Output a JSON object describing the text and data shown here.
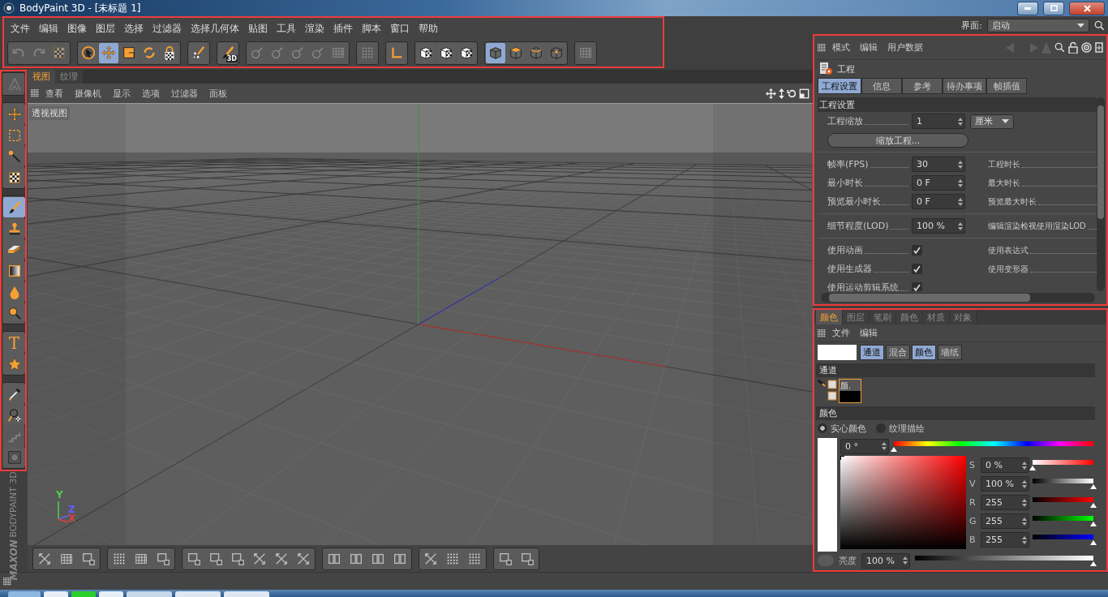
{
  "window": {
    "title": "BodyPaint 3D - [未标题 1]"
  },
  "menu": [
    "文件",
    "编辑",
    "图像",
    "图层",
    "选择",
    "过滤器",
    "选择几何体",
    "贴图",
    "工具",
    "渲染",
    "插件",
    "脚本",
    "窗口",
    "帮助"
  ],
  "toolbar": [
    [
      {
        "kind": "undo",
        "selected": false,
        "disabled": true
      },
      {
        "kind": "redo",
        "selected": false,
        "disabled": true
      },
      {
        "kind": "checker",
        "selected": false,
        "disabled": true
      }
    ],
    [
      {
        "kind": "cursor",
        "selected": false,
        "disabled": false
      },
      {
        "kind": "move",
        "selected": true,
        "disabled": false
      },
      {
        "kind": "scale",
        "selected": false,
        "disabled": false
      },
      {
        "kind": "rotate",
        "selected": false,
        "disabled": false
      },
      {
        "kind": "lock",
        "selected": false,
        "disabled": false
      }
    ],
    [
      {
        "kind": "sparkle",
        "selected": false,
        "disabled": false
      }
    ],
    [
      {
        "kind": "brush",
        "label": "3D",
        "selected": false,
        "disabled": false
      }
    ],
    [
      {
        "kind": "pin",
        "selected": false,
        "disabled": true
      },
      {
        "kind": "pin",
        "selected": false,
        "disabled": true
      },
      {
        "kind": "pin",
        "selected": false,
        "disabled": true
      },
      {
        "kind": "pin",
        "selected": false,
        "disabled": true
      },
      {
        "kind": "grid",
        "selected": false,
        "disabled": true
      }
    ],
    [
      {
        "kind": "dots",
        "selected": false,
        "disabled": true
      }
    ],
    [
      {
        "kind": "axis",
        "selected": false,
        "disabled": false
      }
    ],
    [
      {
        "kind": "checker-cube",
        "selected": false,
        "disabled": false
      },
      {
        "kind": "checker-cube",
        "selected": false,
        "disabled": false
      },
      {
        "kind": "checker-cube",
        "selected": false,
        "disabled": false
      }
    ],
    [
      {
        "kind": "cube",
        "selected": true,
        "disabled": false
      },
      {
        "kind": "cube-face",
        "selected": false,
        "disabled": false
      },
      {
        "kind": "cube-edge",
        "selected": false,
        "disabled": false
      },
      {
        "kind": "cube-point",
        "selected": false,
        "disabled": false
      }
    ],
    [
      {
        "kind": "grid",
        "selected": false,
        "disabled": true
      }
    ]
  ],
  "layout": {
    "label": "界面:",
    "value": "启动"
  },
  "tools": [
    [
      {
        "kind": "logo",
        "selected": false,
        "disabled": true
      }
    ],
    [
      {
        "kind": "move",
        "selected": false,
        "disabled": false
      },
      {
        "kind": "rect-select",
        "selected": false,
        "disabled": false
      },
      {
        "kind": "wand",
        "selected": false,
        "disabled": false
      },
      {
        "kind": "checker",
        "selected": false,
        "disabled": false
      }
    ],
    [
      {
        "kind": "brush",
        "selected": true,
        "disabled": false
      },
      {
        "kind": "stamp",
        "selected": false,
        "disabled": false
      },
      {
        "kind": "eraser",
        "selected": false,
        "disabled": false
      },
      {
        "kind": "gradient",
        "selected": false,
        "disabled": false
      },
      {
        "kind": "drop",
        "selected": false,
        "disabled": false
      },
      {
        "kind": "smudge",
        "selected": false,
        "disabled": false
      }
    ],
    [
      {
        "kind": "text",
        "label": "T",
        "selected": false,
        "disabled": false
      },
      {
        "kind": "star",
        "selected": false,
        "disabled": false
      }
    ],
    [
      {
        "kind": "eyedropper",
        "selected": false,
        "disabled": false
      },
      {
        "kind": "magnifier",
        "selected": false,
        "disabled": false
      },
      {
        "kind": "stairs",
        "selected": false,
        "disabled": true
      },
      {
        "kind": "circle",
        "selected": false,
        "disabled": false
      }
    ]
  ],
  "logo": {
    "brand": "MAXON",
    "product": "BODYPAINT 3D"
  },
  "viewport": {
    "tabs": [
      {
        "label": "视图",
        "selected": true
      },
      {
        "label": "纹理",
        "selected": false
      }
    ],
    "menu": [
      "查看",
      "摄像机",
      "显示",
      "选项",
      "过滤器",
      "面板"
    ],
    "view_label": "透视视图",
    "axes": [
      {
        "label": "Y",
        "color": "#4fd04f"
      },
      {
        "label": "Z",
        "color": "#6060ff"
      },
      {
        "label": "X",
        "color": "#e04040"
      }
    ],
    "bottom_toolbar": [
      [
        {
          "kind": "arrows"
        },
        {
          "kind": "grid"
        },
        {
          "kind": "square"
        }
      ],
      [
        {
          "kind": "dots"
        },
        {
          "kind": "grid"
        },
        {
          "kind": "square"
        }
      ],
      [
        {
          "kind": "square"
        },
        {
          "kind": "square"
        },
        {
          "kind": "square"
        },
        {
          "kind": "arrows"
        },
        {
          "kind": "arrows"
        },
        {
          "kind": "arrows"
        }
      ],
      [
        {
          "kind": "columns"
        },
        {
          "kind": "columns"
        },
        {
          "kind": "columns"
        },
        {
          "kind": "columns"
        }
      ],
      [
        {
          "kind": "arrows"
        },
        {
          "kind": "dots"
        },
        {
          "kind": "dots"
        }
      ],
      [
        {
          "kind": "square"
        },
        {
          "kind": "square"
        }
      ]
    ]
  },
  "attributes": {
    "menu": [
      "模式",
      "编辑",
      "用户数据"
    ],
    "object": "工程",
    "tabs": [
      {
        "label": "工程设置",
        "selected": true
      },
      {
        "label": "信息",
        "selected": false
      },
      {
        "label": "参考",
        "selected": false
      },
      {
        "label": "待办事项",
        "selected": false
      },
      {
        "label": "帧插值",
        "selected": false
      }
    ],
    "section": "工程设置",
    "rows": [
      {
        "kind": "number",
        "label": "工程缩放",
        "value": "1",
        "unit": "厘米"
      },
      {
        "kind": "button",
        "label": "缩放工程..."
      },
      {
        "kind": "divider"
      },
      {
        "kind": "number",
        "label": "帧率(FPS)",
        "value": "30",
        "right_label": "工程时长"
      },
      {
        "kind": "number",
        "label": "最小时长",
        "value": "0 F",
        "right_label": "最大时长"
      },
      {
        "kind": "number",
        "label": "预览最小时长",
        "value": "0 F",
        "right_label": "预览最大时长"
      },
      {
        "kind": "divider"
      },
      {
        "kind": "number",
        "label": "细节程度(LOD)",
        "value": "100 %",
        "right_label": "编辑渲染检视使用渲染LOD"
      },
      {
        "kind": "divider"
      },
      {
        "kind": "check",
        "label": "使用动画",
        "checked": true,
        "right_label": "使用表达式"
      },
      {
        "kind": "check",
        "label": "使用生成器",
        "checked": true,
        "right_label": "使用变形器"
      },
      {
        "kind": "check",
        "label": "使用运动剪辑系统",
        "checked": true
      }
    ]
  },
  "color_panel": {
    "tabs": [
      {
        "label": "颜色",
        "selected": true
      },
      {
        "label": "图层",
        "selected": false
      },
      {
        "label": "笔刷",
        "selected": false
      },
      {
        "label": "颜色",
        "selected": false
      },
      {
        "label": "材质",
        "selected": false
      },
      {
        "label": "对象",
        "selected": false
      }
    ],
    "menu": [
      "文件",
      "编辑"
    ],
    "modes": [
      {
        "label": "通道",
        "selected": true
      },
      {
        "label": "混合",
        "selected": false
      },
      {
        "label": "颜色",
        "selected": true
      },
      {
        "label": "墙纸",
        "selected": false
      }
    ],
    "channel_section": "通道",
    "channel": {
      "label": "颜.",
      "selected": true
    },
    "color_section": "颜色",
    "sources": [
      {
        "label": "实心颜色",
        "selected": true
      },
      {
        "label": "纹理描绘",
        "selected": false
      }
    ],
    "hue": {
      "value": "0 °",
      "level": 0
    },
    "sliders": [
      {
        "kind": "saturation",
        "label": "S",
        "value": "0 %",
        "level": 0
      },
      {
        "kind": "value",
        "label": "V",
        "value": "100 %",
        "level": 1
      },
      {
        "kind": "red",
        "label": "R",
        "value": "255",
        "level": 1
      },
      {
        "kind": "green",
        "label": "G",
        "value": "255",
        "level": 1
      },
      {
        "kind": "blue",
        "label": "B",
        "value": "255",
        "level": 1
      }
    ],
    "brightness": {
      "label": "亮度",
      "value": "100 %",
      "level": 1
    }
  }
}
